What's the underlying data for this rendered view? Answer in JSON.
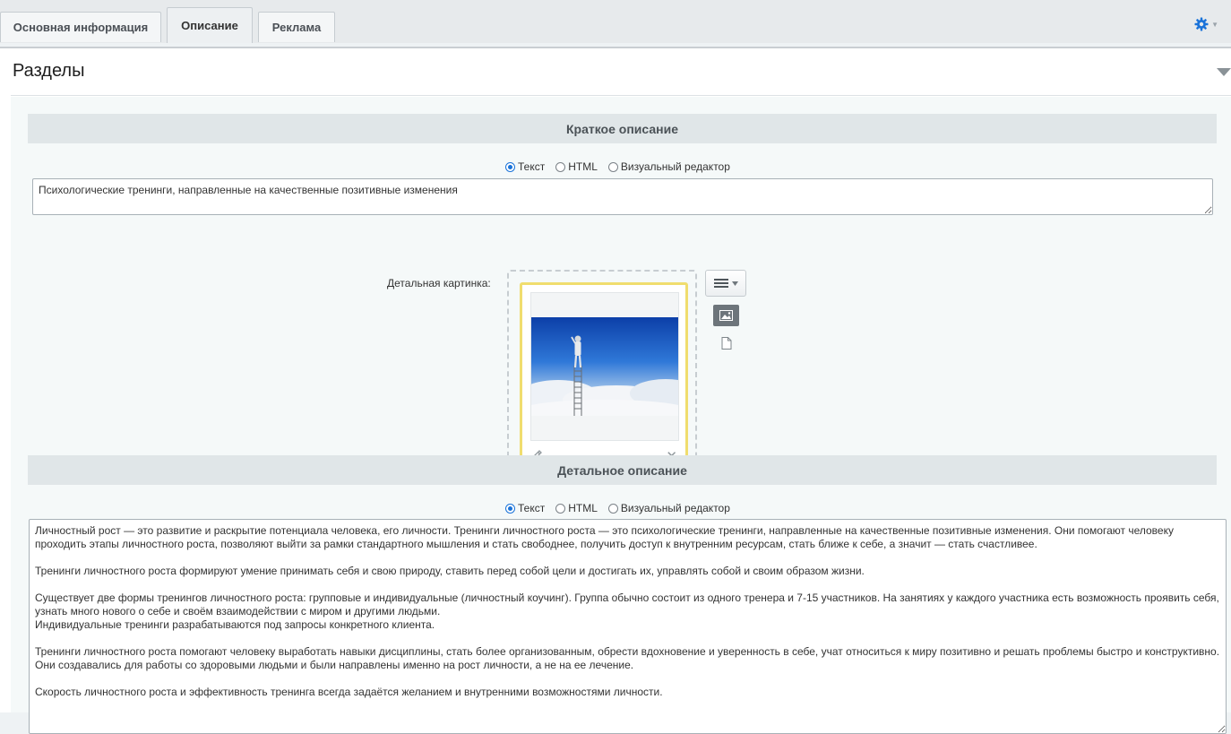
{
  "tabs": [
    {
      "label": "Основная информация",
      "active": false
    },
    {
      "label": "Описание",
      "active": true
    },
    {
      "label": "Реклама",
      "active": false
    }
  ],
  "settings_icon": "gear-icon",
  "accent_color": "#1a73d9",
  "panel": {
    "title": "Разделы"
  },
  "short_description": {
    "header": "Краткое описание",
    "modes": [
      "Текст",
      "HTML",
      "Визуальный редактор"
    ],
    "selected_mode": "Текст",
    "value": "Психологические тренинги, направленные на качественные позитивные изменения"
  },
  "detail_picture": {
    "label": "Детальная картинка:",
    "image": "person-on-ladder-above-clouds"
  },
  "detail_description": {
    "header": "Детальное описание",
    "modes": [
      "Текст",
      "HTML",
      "Визуальный редактор"
    ],
    "selected_mode": "Текст",
    "value": "Личностный рост — это развитие и раскрытие потенциала человека, его личности. Тренинги личностного роста — это психологические тренинги, направленные на качественные позитивные изменения. Они помогают человеку проходить этапы личностного роста, позволяют выйти за рамки стандартного мышления и стать свободнее, получить доступ к внутренним ресурсам, стать ближе к себе, а значит — стать счастливее.\n\nТренинги личностного роста формируют умение принимать себя и свою природу, ставить перед собой цели и достигать их, управлять собой и своим образом жизни.\n\nСуществует две формы тренингов личностного роста: групповые и индивидуальные (личностный коучинг). Группа обычно состоит из одного тренера и 7-15 участников. На занятиях у каждого участника есть возможность проявить себя, узнать много нового о себе и своём взаимодействии с миром и другими людьми.\nИндивидуальные тренинги разрабатываются под запросы конкретного клиента.\n\nТренинги личностного роста помогают человеку выработать навыки дисциплины, стать более организованным, обрести вдохновение и уверенность в себе, учат относиться к миру позитивно и решать проблемы быстро и конструктивно. Они создавались для работы со здоровыми людьми и были направлены именно на рост личности, а не на ее лечение.\n\nСкорость личностного роста и эффективность тренинга всегда задаётся желанием и внутренними возможностями личности."
  }
}
